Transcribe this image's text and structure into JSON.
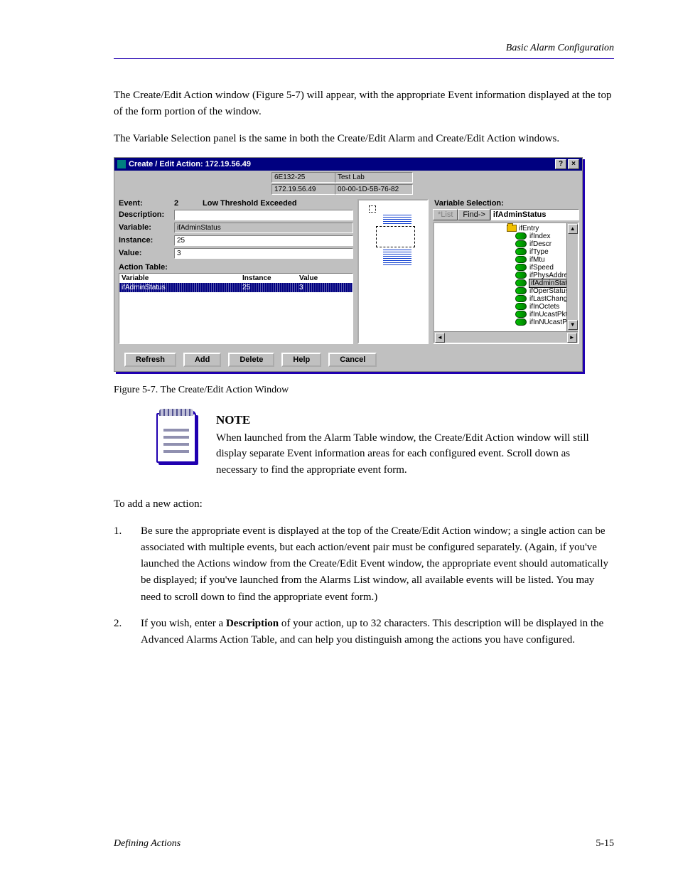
{
  "header": {
    "section": "Basic Alarm Configuration"
  },
  "para1": "The Create/Edit Action window (Figure 5-7) will appear, with the appropriate Event information displayed at the top of the form portion of the window.",
  "para2": "The Variable Selection panel is the same in both the Create/Edit Alarm and Create/Edit Action windows.",
  "window": {
    "title": "Create / Edit Action: 172.19.56.49",
    "info": {
      "model": "6E132-25",
      "ip": "172.19.56.49",
      "loc": "Test Lab",
      "mac": "00-00-1D-5B-76-82"
    },
    "event_label": "Event:",
    "event_num": "2",
    "event_text": "Low Threshold Exceeded",
    "desc_label": "Description:",
    "var_label": "Variable:",
    "var_value": "ifAdminStatus",
    "inst_label": "Instance:",
    "inst_value": "25",
    "val_label": "Value:",
    "val_value": "3",
    "at_label": "Action Table:",
    "at_head": {
      "c1": "Variable",
      "c2": "Instance",
      "c3": "Value"
    },
    "at_row": {
      "c1": "ifAdminStatus",
      "c2": "25",
      "c3": "3"
    },
    "vs_label": "Variable Selection:",
    "vs_list": "*List",
    "vs_find": "Find->",
    "vs_search": "ifAdminStatus",
    "tree_parent": "ifEntry",
    "tree": [
      "ifIndex",
      "ifDescr",
      "ifType",
      "ifMtu",
      "ifSpeed",
      "ifPhysAddress",
      "ifAdminStatus",
      "ifOperStatus",
      "ifLastChange",
      "ifInOctets",
      "ifInUcastPkts",
      "ifInNUcastPkts"
    ],
    "tree_sel": "ifAdminStatus",
    "buttons": {
      "refresh": "Refresh",
      "add": "Add",
      "delete": "Delete",
      "help": "Help",
      "cancel": "Cancel"
    }
  },
  "fig_label": "Figure 5-7. The Create/Edit Action Window",
  "note": {
    "head": "NOTE",
    "body": "When launched from the Alarm Table window, the Create/Edit Action window will still display separate Event information areas for each configured event. Scroll down as necessary to find the appropriate event form."
  },
  "list_intro": "To add a new action:",
  "steps": [
    "Be sure the appropriate event is displayed at the top of the Create/Edit Action window; a single action can be associated with multiple events, but each action/event pair must be configured separately. (Again, if you've launched the Actions window from the Create/Edit Event window, the appropriate event should automatically be displayed; if you've launched from the Alarms List window, all available events will be listed. You may need to scroll down to find the appropriate event form.)",
    "If you wish, enter a Description of your action, up to 32 characters. This description will be displayed in the Advanced Alarms Action Table, and can help you distinguish among the actions you have configured."
  ],
  "footer": {
    "left": "Defining Actions",
    "right": "5-15"
  }
}
